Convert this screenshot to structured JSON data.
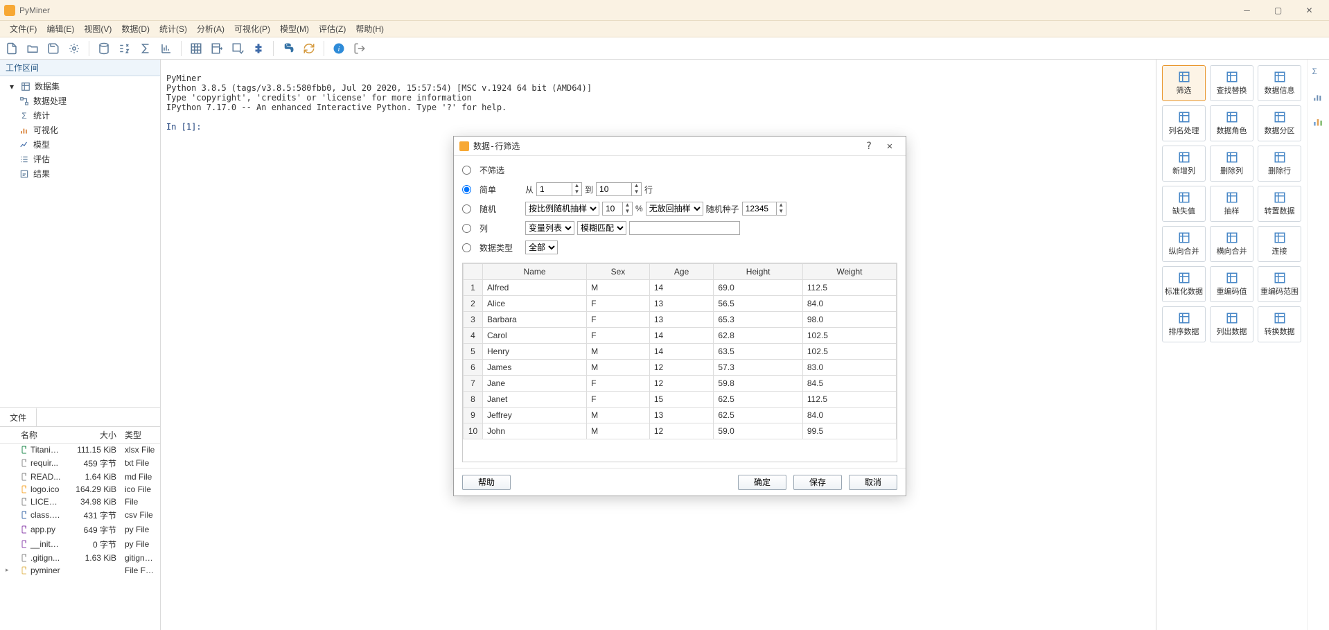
{
  "window": {
    "title": "PyMiner"
  },
  "menus": [
    "文件(F)",
    "编辑(E)",
    "视图(V)",
    "数据(D)",
    "统计(S)",
    "分析(A)",
    "可视化(P)",
    "模型(M)",
    "评估(Z)",
    "帮助(H)"
  ],
  "workspace": {
    "header": "工作区间",
    "root": "数据集",
    "items": [
      "数据处理",
      "统计",
      "可视化",
      "模型",
      "评估",
      "结果"
    ]
  },
  "file_panel": {
    "tab": "文件",
    "cols": {
      "name": "名称",
      "size": "大小",
      "type": "类型"
    },
    "rows": [
      {
        "caret": "",
        "icon": "xls",
        "name": "Titanic...",
        "size": "111.15 KiB",
        "type": "xlsx File"
      },
      {
        "caret": "",
        "icon": "txt",
        "name": "requir...",
        "size": "459 字节",
        "type": "txt File"
      },
      {
        "caret": "",
        "icon": "md",
        "name": "READ...",
        "size": "1.64 KiB",
        "type": "md File"
      },
      {
        "caret": "",
        "icon": "ico",
        "name": "logo.ico",
        "size": "164.29 KiB",
        "type": "ico File"
      },
      {
        "caret": "",
        "icon": "txt",
        "name": "LICENSE",
        "size": "34.98 KiB",
        "type": "File"
      },
      {
        "caret": "",
        "icon": "csv",
        "name": "class.csv",
        "size": "431 字节",
        "type": "csv File"
      },
      {
        "caret": "",
        "icon": "py",
        "name": "app.py",
        "size": "649 字节",
        "type": "py File"
      },
      {
        "caret": "",
        "icon": "py",
        "name": "__init__...",
        "size": "0 字节",
        "type": "py File"
      },
      {
        "caret": "",
        "icon": "git",
        "name": ".gitign...",
        "size": "1.63 KiB",
        "type": "gitignore Fi"
      },
      {
        "caret": "▸",
        "icon": "folder",
        "name": "pyminer",
        "size": "",
        "type": "File Folder"
      }
    ]
  },
  "console": {
    "lines": [
      "PyMiner",
      "Python 3.8.5 (tags/v3.8.5:580fbb0, Jul 20 2020, 15:57:54) [MSC v.1924 64 bit (AMD64)]",
      "Type 'copyright', 'credits' or 'license' for more information",
      "IPython 7.17.0 -- An enhanced Interactive Python. Type '?' for help."
    ],
    "prompt": "In [1]:"
  },
  "right_tools": [
    {
      "id": "filter",
      "label": "筛选",
      "active": true
    },
    {
      "id": "find-replace",
      "label": "查找替换"
    },
    {
      "id": "data-info",
      "label": "数据信息"
    },
    {
      "id": "col-name",
      "label": "列名处理"
    },
    {
      "id": "data-role",
      "label": "数据角色"
    },
    {
      "id": "data-partition",
      "label": "数据分区"
    },
    {
      "id": "new-col",
      "label": "新增列"
    },
    {
      "id": "del-col",
      "label": "删除列"
    },
    {
      "id": "del-row",
      "label": "删除行"
    },
    {
      "id": "missing",
      "label": "缺失值"
    },
    {
      "id": "sample",
      "label": "抽样"
    },
    {
      "id": "transpose",
      "label": "转置数据"
    },
    {
      "id": "v-merge",
      "label": "纵向合并"
    },
    {
      "id": "h-merge",
      "label": "横向合并"
    },
    {
      "id": "join",
      "label": "连接"
    },
    {
      "id": "normalize",
      "label": "标准化数据"
    },
    {
      "id": "recode-val",
      "label": "重编码值"
    },
    {
      "id": "recode-range",
      "label": "重编码范围"
    },
    {
      "id": "sort",
      "label": "排序数据"
    },
    {
      "id": "col-out",
      "label": "列出数据"
    },
    {
      "id": "convert",
      "label": "转换数据"
    }
  ],
  "dialog": {
    "title": "数据-行筛选",
    "options": {
      "none": "不筛选",
      "simple": "简单",
      "random": "随机",
      "column": "列",
      "dtype": "数据类型"
    },
    "simple": {
      "from_label": "从",
      "from": "1",
      "to_label": "到",
      "to": "10",
      "row_label": "行"
    },
    "random": {
      "method": "按比例随机抽样",
      "pct": "10",
      "pct_suffix": "%",
      "replace": "无放回抽样",
      "seed_label": "随机种子",
      "seed": "12345"
    },
    "column": {
      "list": "变量列表",
      "match": "模糊匹配",
      "value": ""
    },
    "dtype": {
      "all": "全部"
    },
    "table": {
      "headers": [
        "Name",
        "Sex",
        "Age",
        "Height",
        "Weight"
      ],
      "rows": [
        [
          "Alfred",
          "M",
          "14",
          "69.0",
          "112.5"
        ],
        [
          "Alice",
          "F",
          "13",
          "56.5",
          "84.0"
        ],
        [
          "Barbara",
          "F",
          "13",
          "65.3",
          "98.0"
        ],
        [
          "Carol",
          "F",
          "14",
          "62.8",
          "102.5"
        ],
        [
          "Henry",
          "M",
          "14",
          "63.5",
          "102.5"
        ],
        [
          "James",
          "M",
          "12",
          "57.3",
          "83.0"
        ],
        [
          "Jane",
          "F",
          "12",
          "59.8",
          "84.5"
        ],
        [
          "Janet",
          "F",
          "15",
          "62.5",
          "112.5"
        ],
        [
          "Jeffrey",
          "M",
          "13",
          "62.5",
          "84.0"
        ],
        [
          "John",
          "M",
          "12",
          "59.0",
          "99.5"
        ]
      ]
    },
    "buttons": {
      "help": "帮助",
      "ok": "确定",
      "save": "保存",
      "cancel": "取消"
    }
  }
}
